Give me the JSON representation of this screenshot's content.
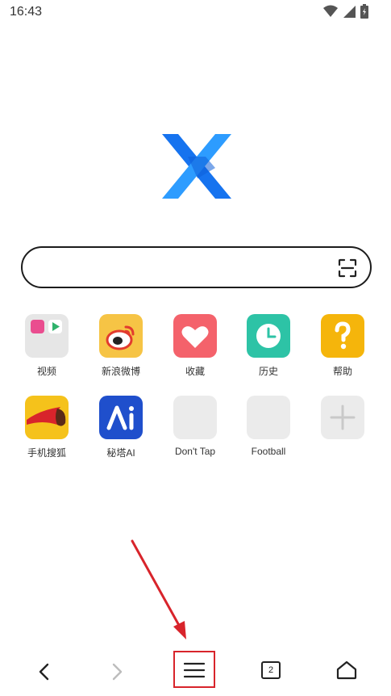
{
  "status_bar": {
    "time": "16:43",
    "icons": [
      "wifi-icon",
      "cellular-signal-icon",
      "battery-icon"
    ]
  },
  "logo": {
    "name": "x-logo",
    "colors": [
      "#1673ef",
      "#2d9cff"
    ]
  },
  "search": {
    "value": "",
    "placeholder": ""
  },
  "shortcuts": [
    {
      "label": "视频",
      "icon": "video-folder-icon",
      "color": "#e6e6e6"
    },
    {
      "label": "新浪微博",
      "icon": "weibo-icon",
      "color": "#f6c445"
    },
    {
      "label": "收藏",
      "icon": "heart-icon",
      "color": "#f4626b"
    },
    {
      "label": "历史",
      "icon": "clock-icon",
      "color": "#2dc3a6"
    },
    {
      "label": "帮助",
      "icon": "question-icon",
      "color": "#f5b50b"
    },
    {
      "label": "手机搜狐",
      "icon": "sohu-fox-icon",
      "color": "#f5c21b"
    },
    {
      "label": "秘塔AI",
      "icon": "metaso-ai-icon",
      "color": "#1f4fcc"
    },
    {
      "label": "Don't Tap",
      "icon": "blank-tile-icon",
      "color": "#ebebeb"
    },
    {
      "label": "Football",
      "icon": "blank-tile-icon",
      "color": "#ebebeb"
    },
    {
      "label": "",
      "icon": "plus-icon",
      "color": "#ebebeb"
    }
  ],
  "bottom_nav": {
    "tab_count": "2",
    "items": [
      "back-icon",
      "forward-icon",
      "menu-icon",
      "tabs-icon",
      "home-icon"
    ]
  },
  "annotation": {
    "highlight_color": "#d8242b",
    "target": "menu-button"
  }
}
